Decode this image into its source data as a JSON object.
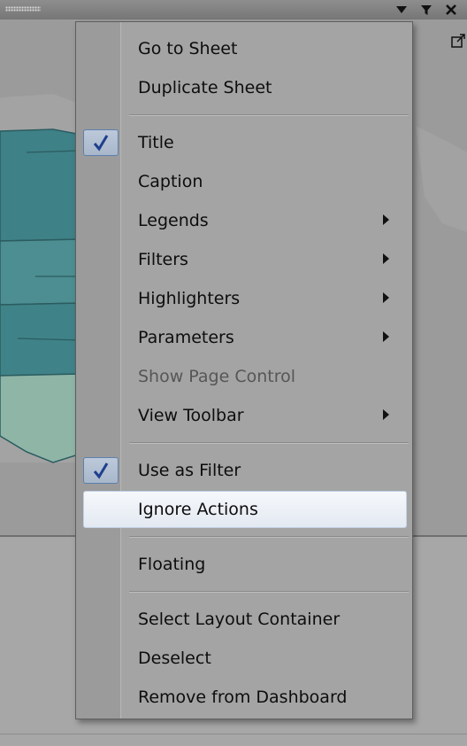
{
  "menu": {
    "items": [
      {
        "label": "Go to Sheet",
        "checked": false,
        "submenu": false,
        "disabled": false
      },
      {
        "label": "Duplicate Sheet",
        "checked": false,
        "submenu": false,
        "disabled": false
      },
      {
        "label": "Title",
        "checked": true,
        "submenu": false,
        "disabled": false
      },
      {
        "label": "Caption",
        "checked": false,
        "submenu": false,
        "disabled": false
      },
      {
        "label": "Legends",
        "checked": false,
        "submenu": true,
        "disabled": false
      },
      {
        "label": "Filters",
        "checked": false,
        "submenu": true,
        "disabled": false
      },
      {
        "label": "Highlighters",
        "checked": false,
        "submenu": true,
        "disabled": false
      },
      {
        "label": "Parameters",
        "checked": false,
        "submenu": true,
        "disabled": false
      },
      {
        "label": "Show Page Control",
        "checked": false,
        "submenu": false,
        "disabled": true
      },
      {
        "label": "View Toolbar",
        "checked": false,
        "submenu": true,
        "disabled": false
      },
      {
        "label": "Use as Filter",
        "checked": true,
        "submenu": false,
        "disabled": false
      },
      {
        "label": "Ignore Actions",
        "checked": false,
        "submenu": false,
        "disabled": false,
        "highlighted": true
      },
      {
        "label": "Floating",
        "checked": false,
        "submenu": false,
        "disabled": false
      },
      {
        "label": "Select Layout Container",
        "checked": false,
        "submenu": false,
        "disabled": false
      },
      {
        "label": "Deselect",
        "checked": false,
        "submenu": false,
        "disabled": false
      },
      {
        "label": "Remove from Dashboard",
        "checked": false,
        "submenu": false,
        "disabled": false
      }
    ]
  },
  "colors": {
    "check_mark": "#1f3f8f",
    "map_fill": "#4f8f93",
    "map_light": "#8fb5a7",
    "highlight": "#e8eef6"
  },
  "icons": {
    "toolbar": [
      "dropdown-arrow-icon",
      "filter-icon",
      "close-icon"
    ],
    "popout": "popout-icon",
    "grip": "drag-grip-icon"
  }
}
